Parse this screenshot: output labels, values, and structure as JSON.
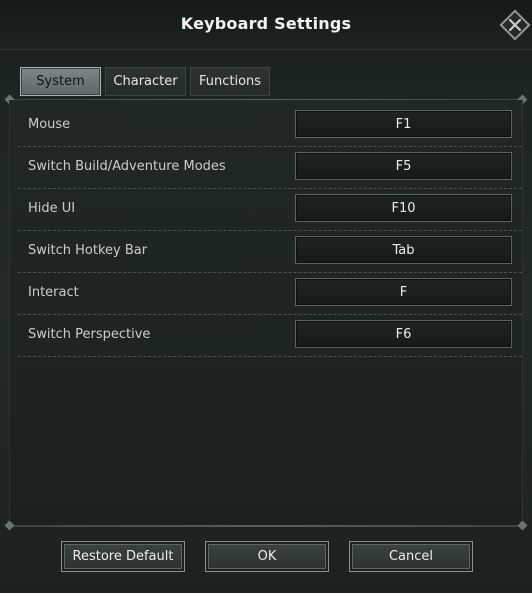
{
  "dialog": {
    "title": "Keyboard Settings",
    "close_icon": "close-x-icon"
  },
  "tabs": [
    {
      "label": "System",
      "active": true
    },
    {
      "label": "Character",
      "active": false
    },
    {
      "label": "Functions",
      "active": false
    }
  ],
  "bindings": [
    {
      "action": "Mouse",
      "key": "F1"
    },
    {
      "action": "Switch Build/Adventure Modes",
      "key": "F5"
    },
    {
      "action": "Hide UI",
      "key": "F10"
    },
    {
      "action": "Switch Hotkey Bar",
      "key": "Tab"
    },
    {
      "action": "Interact",
      "key": "F"
    },
    {
      "action": "Switch Perspective",
      "key": "F6"
    }
  ],
  "footer": {
    "restore_label": "Restore Default",
    "ok_label": "OK",
    "cancel_label": "Cancel"
  },
  "colors": {
    "background": "#1c2323",
    "tab_active": "#7e8787",
    "button_border": "#8a9292"
  }
}
